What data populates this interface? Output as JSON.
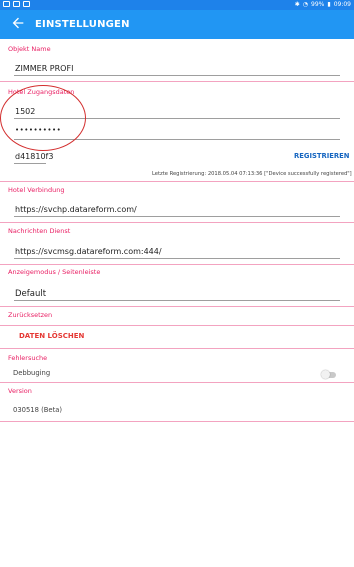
{
  "status": {
    "battery": "99%",
    "time": "09:09"
  },
  "appbar": {
    "title": "EINSTELLUNGEN"
  },
  "sections": {
    "objekt_name": {
      "label": "Objekt Name",
      "value": "ZIMMER PROFI"
    },
    "hotel_zugangsdaten": {
      "label": "Hotel Zugangsdaten",
      "user": "1502",
      "password": "••••••••••"
    },
    "registration": {
      "code": "d41810f3",
      "button": "REGISTRIEREN",
      "info": "Letzte Registrierung: 2018.05.04 07:13:36 [\"Device successfully registered\"]"
    },
    "hotel_verbindung": {
      "label": "Hotel Verbindung",
      "value": "https://svchp.datareform.com/"
    },
    "nachrichten_dienst": {
      "label": "Nachrichten Dienst",
      "value": "https://svcmsg.datareform.com:444/"
    },
    "anzeigemodus": {
      "label": "Anzeigemodus / Seitenleiste",
      "value": "Default"
    },
    "zuruecksetzen": {
      "label": "Zurücksetzen",
      "button": "DATEN LÖSCHEN"
    },
    "fehlersuche": {
      "label": "Fehlersuche",
      "debug_label": "Debbuging"
    },
    "version": {
      "label": "Version",
      "value": "030518 (Beta)"
    }
  }
}
